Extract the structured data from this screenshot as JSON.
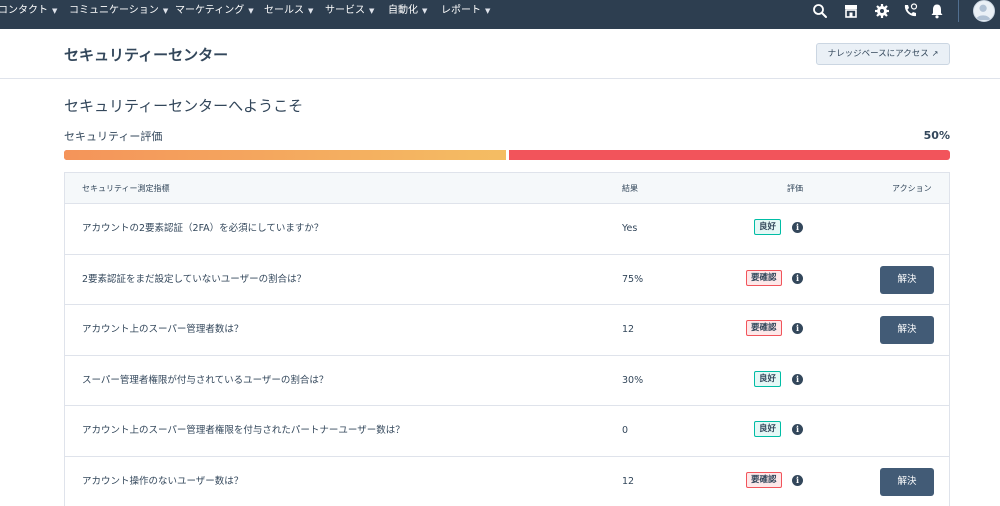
{
  "nav": {
    "items": [
      {
        "label": "コンタクト"
      },
      {
        "label": "コミュニケーション"
      },
      {
        "label": "マーケティング"
      },
      {
        "label": "セールス"
      },
      {
        "label": "サービス"
      },
      {
        "label": "自動化"
      },
      {
        "label": "レポート"
      }
    ],
    "icons": [
      "search-icon",
      "marketplace-icon",
      "settings-icon",
      "calling-icon",
      "notifications-icon",
      "avatar-icon"
    ]
  },
  "header": {
    "title": "セキュリティーセンター",
    "kb_button": "ナレッジベースにアクセス"
  },
  "welcome": "セキュリティーセンターへようこそ",
  "score": {
    "label": "セキュリティー評価",
    "value_text": "50%",
    "fraction": 0.5,
    "colors": {
      "fill_start": "#f4945a",
      "fill_end": "#f4bd63",
      "remaining": "#f2545b"
    }
  },
  "table": {
    "headers": {
      "metric": "セキュリティー測定指標",
      "result": "結果",
      "rating": "評価",
      "action": "アクション"
    },
    "rows": [
      {
        "question": "アカウントの2要素認証（2FA）を必須にしていますか？",
        "result": "Yes",
        "rating": "良好",
        "status": "good",
        "action": ""
      },
      {
        "question": "2要素認証をまだ設定していないユーザーの割合は？",
        "result": "75%",
        "rating": "要確認",
        "status": "warn",
        "action": "解決"
      },
      {
        "question": "アカウント上のスーパー管理者数は？",
        "result": "12",
        "rating": "要確認",
        "status": "warn",
        "action": "解決"
      },
      {
        "question": "スーパー管理者権限が付与されているユーザーの割合は？",
        "result": "30%",
        "rating": "良好",
        "status": "good",
        "action": ""
      },
      {
        "question": "アカウント上のスーパー管理者権限を付与されたパートナーユーザー数は？",
        "result": "0",
        "rating": "良好",
        "status": "good",
        "action": ""
      },
      {
        "question": "アカウント操作のないユーザー数は？",
        "result": "12",
        "rating": "要確認",
        "status": "warn",
        "action": "解決"
      }
    ]
  }
}
